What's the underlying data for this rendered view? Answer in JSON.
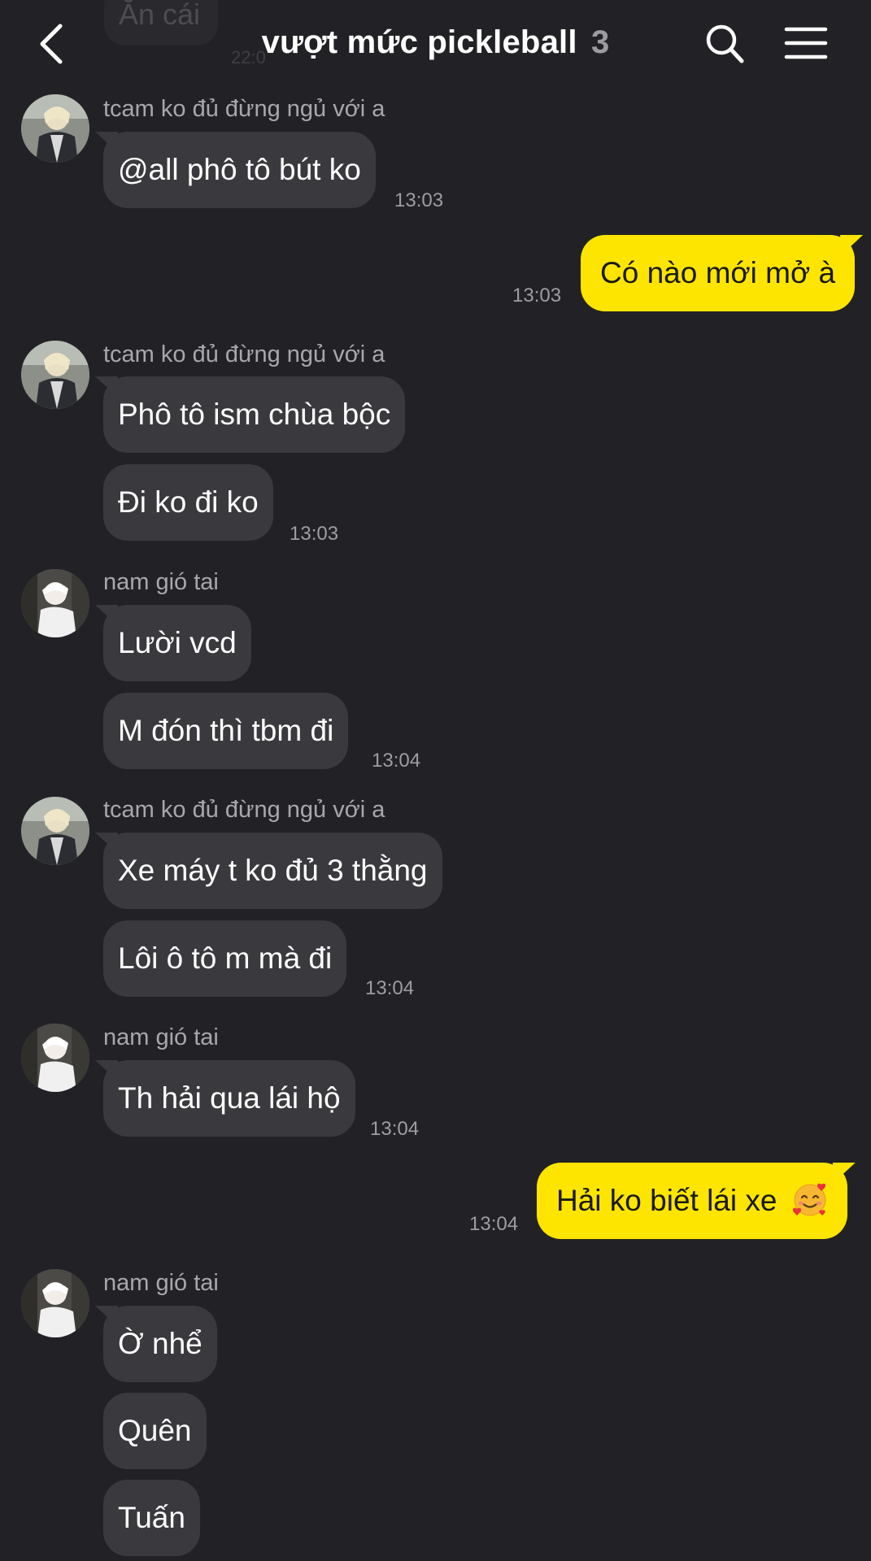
{
  "header": {
    "title": "vượt mức pickleball",
    "member_count": "3",
    "back_icon": "chevron-left-icon",
    "search_icon": "search-icon",
    "menu_icon": "hamburger-menu-icon",
    "previous_message": {
      "text": "Ăn cái",
      "time": "22:0"
    }
  },
  "colors": {
    "background": "#222226",
    "incoming_bubble": "#3a3a3e",
    "outgoing_bubble": "#fee500",
    "sender_name": "#a7a7ad",
    "timestamp": "#9d9da2"
  },
  "messages": [
    {
      "sender": "tcam ko đủ đừng ngủ với a",
      "text": "@all phô tô bút ko",
      "time": "13:03"
    },
    {
      "text": "Có nào mới mở à",
      "time": "13:03",
      "mine": true
    },
    {
      "sender": "tcam ko đủ đừng ngủ với a",
      "text": "Phô tô ism chùa bộc"
    },
    {
      "text": "Đi ko đi ko",
      "time": "13:03"
    },
    {
      "sender": "nam gió tai",
      "text": "Lười vcd"
    },
    {
      "text": "M đón thì tbm đi",
      "time": "13:04"
    },
    {
      "sender": "tcam ko đủ đừng ngủ với a",
      "text": "Xe máy t ko đủ 3 thằng"
    },
    {
      "text": "Lôi ô tô m mà đi",
      "time": "13:04"
    },
    {
      "sender": "nam gió tai",
      "text": "Th hải qua lái hộ",
      "time": "13:04"
    },
    {
      "text": "Hải ko biết lái xe",
      "emoji": "smiling-face-with-hearts-emoji",
      "time": "13:04",
      "mine": true
    },
    {
      "sender": "nam gió tai",
      "text": "Ờ nhể"
    },
    {
      "text": "Quên"
    },
    {
      "text": "Tuấn"
    }
  ]
}
